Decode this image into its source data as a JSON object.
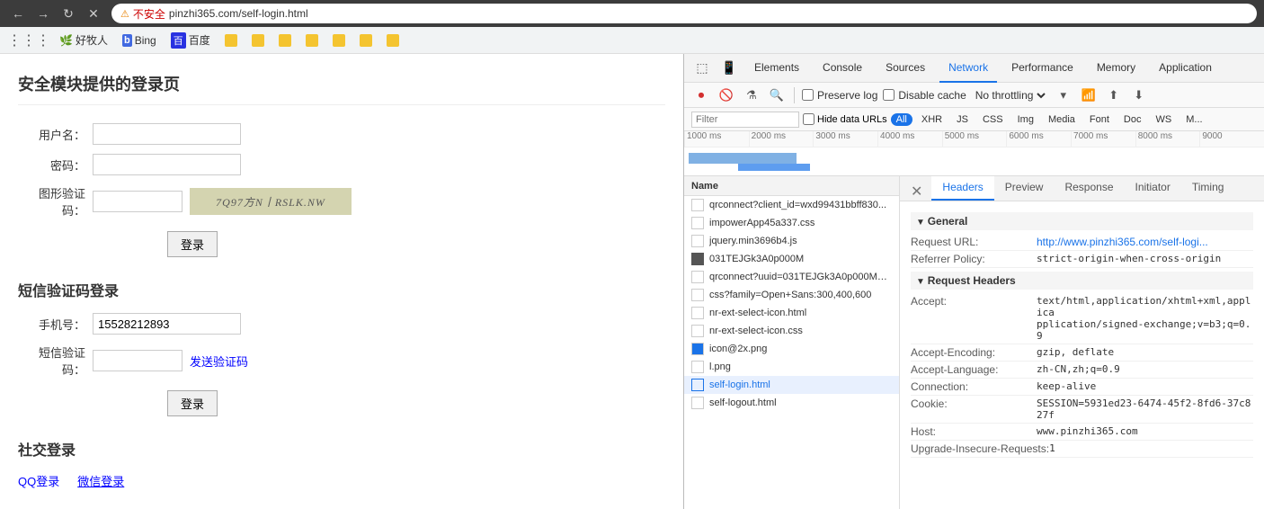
{
  "browser": {
    "back_label": "←",
    "forward_label": "→",
    "reload_label": "↻",
    "close_label": "✕",
    "security_icon": "⚠",
    "security_text": "不安全",
    "address": "pinzhi365.com/self-login.html",
    "address_full": "pinzhi365.com/self-login.html"
  },
  "bookmarks": [
    {
      "label": "好牧人",
      "icon": "🌿"
    },
    {
      "label": "Bing",
      "icon": "Ⓑ"
    },
    {
      "label": "百度",
      "icon": "🅱"
    },
    {
      "label": ""
    },
    {
      "label": ""
    },
    {
      "label": ""
    },
    {
      "label": ""
    },
    {
      "label": ""
    },
    {
      "label": ""
    },
    {
      "label": ""
    }
  ],
  "page": {
    "title": "安全模块提供的登录页",
    "security_section": {
      "username_label": "用户名：",
      "username_placeholder": "",
      "password_label": "密码：",
      "password_placeholder": "",
      "captcha_label": "图形验证码：",
      "captcha_value": "7Q97方N丨RSLK.NW",
      "login_btn": "登录"
    },
    "sms_section": {
      "title": "短信验证码登录",
      "phone_label": "手机号：",
      "phone_value": "15528212893",
      "sms_label": "短信验证码：",
      "sms_placeholder": "",
      "send_btn": "发送验证码",
      "login_btn": "登录"
    },
    "social_section": {
      "title": "社交登录",
      "qq_label": "QQ登录",
      "wechat_label": "微信登录"
    }
  },
  "devtools": {
    "tabs": [
      "Elements",
      "Console",
      "Sources",
      "Network",
      "Performance",
      "Memory",
      "Application"
    ],
    "active_tab": "Network",
    "toolbar": {
      "preserve_log": "Preserve log",
      "disable_cache": "Disable cache",
      "no_throttling": "No throttling"
    },
    "filter_bar": {
      "filter_placeholder": "Filter",
      "hide_data_urls": "Hide data URLs",
      "all_label": "All",
      "xhr_label": "XHR",
      "js_label": "JS",
      "css_label": "CSS",
      "img_label": "Img",
      "media_label": "Media",
      "font_label": "Font",
      "doc_label": "Doc",
      "ws_label": "WS",
      "m_label": "M..."
    },
    "timeline": {
      "ticks": [
        "1000 ms",
        "2000 ms",
        "3000 ms",
        "4000 ms",
        "5000 ms",
        "6000 ms",
        "7000 ms",
        "8000 ms",
        "9000"
      ]
    },
    "network_items": [
      {
        "name": "qrconnect?client_id=wxd99431bbff830...",
        "icon": "file",
        "selected": false
      },
      {
        "name": "impowerApp45a337.css",
        "icon": "file",
        "selected": false
      },
      {
        "name": "jquery.min3696b4.js",
        "icon": "file",
        "selected": false
      },
      {
        "name": "031TEJGk3A0p000M",
        "icon": "image",
        "selected": false
      },
      {
        "name": "qrconnect?uuid=031TEJGk3A0p000M&...",
        "icon": "file",
        "selected": false
      },
      {
        "name": "css?family=Open+Sans:300,400,600",
        "icon": "file",
        "selected": false
      },
      {
        "name": "nr-ext-select-icon.html",
        "icon": "file",
        "selected": false
      },
      {
        "name": "nr-ext-select-icon.css",
        "icon": "file",
        "selected": false
      },
      {
        "name": "icon@2x.png",
        "icon": "image-blue",
        "selected": false
      },
      {
        "name": "l.png",
        "icon": "file",
        "selected": false
      },
      {
        "name": "self-login.html",
        "icon": "file",
        "selected": true
      },
      {
        "name": "self-logout.html",
        "icon": "file",
        "selected": false
      }
    ],
    "details": {
      "tabs": [
        "Headers",
        "Preview",
        "Response",
        "Initiator",
        "Timing"
      ],
      "active_tab": "Headers",
      "general": {
        "label": "General",
        "request_url_label": "Request URL:",
        "request_url_value": "http://www.pinzhi365.com/self-logi...",
        "referrer_policy_label": "Referrer Policy:",
        "referrer_policy_value": "strict-origin-when-cross-origin"
      },
      "request_headers": {
        "label": "Request Headers",
        "accept_label": "Accept:",
        "accept_value": "text/html,application/xhtml+xml,applica",
        "accept_value2": "pplication/signed-exchange;v=b3;q=0.9",
        "encoding_label": "Accept-Encoding:",
        "encoding_value": "gzip, deflate",
        "language_label": "Accept-Language:",
        "language_value": "zh-CN,zh;q=0.9",
        "connection_label": "Connection:",
        "connection_value": "keep-alive",
        "cookie_label": "Cookie:",
        "cookie_value": "SESSION=5931ed23-6474-45f2-8fd6-37c827f",
        "host_label": "Host:",
        "host_value": "www.pinzhi365.com",
        "upgrade_label": "Upgrade-Insecure-Requests:",
        "upgrade_value": "1"
      }
    }
  }
}
